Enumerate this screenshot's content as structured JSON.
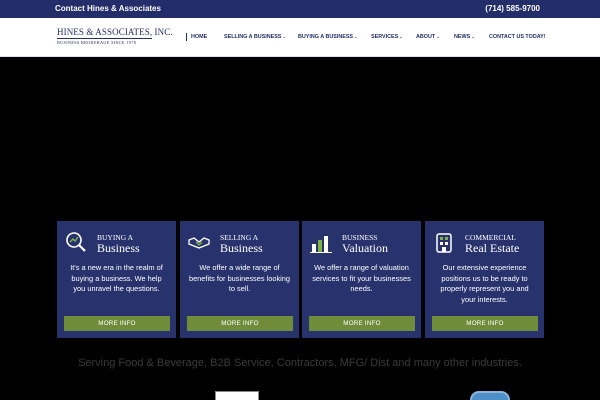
{
  "topbar": {
    "contact": "Contact Hines & Associates",
    "phone": "(714) 585-9700"
  },
  "logo": {
    "name": "HINES & ASSOCIATES, INC.",
    "tagline": "BUSINESS BROKERAGE SINCE 1978"
  },
  "nav": [
    {
      "label": "HOME",
      "active": true
    },
    {
      "label": "SELLING A BUSINESS",
      "dropdown": true
    },
    {
      "label": "BUYING A BUSINESS",
      "dropdown": true
    },
    {
      "label": "SERVICES",
      "dropdown": true
    },
    {
      "label": "ABOUT",
      "dropdown": true
    },
    {
      "label": "NEWS",
      "dropdown": true
    },
    {
      "label": "CONTACT US TODAY!"
    }
  ],
  "cards": [
    {
      "small": "BUYING A",
      "big": "Business",
      "icon": "magnifier-graph-icon",
      "desc": "It's a new era in the realm of buying a business. We help you unravel the questions.",
      "button": "MORE INFO"
    },
    {
      "small": "SELLING A",
      "big": "Business",
      "icon": "handshake-icon",
      "desc": "We offer a wide range of benefits for businesses looking to sell.",
      "button": "MORE INFO"
    },
    {
      "small": "BUSINESS",
      "big": "Valuation",
      "icon": "bar-chart-icon",
      "desc": "We offer a range of valuation services to fit your businesses needs.",
      "button": "MORE INFO"
    },
    {
      "small": "COMMERCIAL",
      "big": "Real Estate",
      "icon": "building-icon",
      "desc": "Our extensive experience positions us to be ready to properly represent you and your interests.",
      "button": "MORE INFO"
    }
  ],
  "serving": "Serving Food & Beverage, B2B Service, Contractors, MFG/ Dist and many other industries.",
  "colors": {
    "navy": "#232d6a",
    "card": "#28336e",
    "button": "#6e8c3a"
  }
}
